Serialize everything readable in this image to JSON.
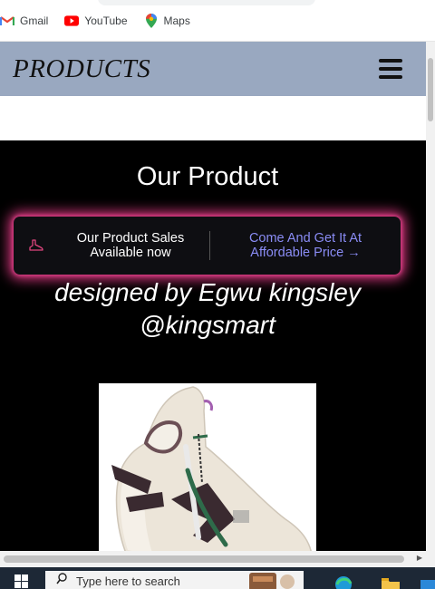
{
  "bookmarks": [
    {
      "label": "Gmail",
      "icon": "gmail-icon"
    },
    {
      "label": "YouTube",
      "icon": "youtube-icon"
    },
    {
      "label": "Maps",
      "icon": "maps-icon"
    }
  ],
  "navbar": {
    "brand": "PRODUCTS",
    "menu_icon": "hamburger-menu-icon",
    "bg_color": "#99a8c0"
  },
  "hero": {
    "title": "Our Product",
    "promo": {
      "left_line1": "Our Product Sales",
      "left_line2": "Available now",
      "right_line1": "Come And Get It At",
      "right_line2": "Affordable Price →",
      "glow_color": "#d9377f",
      "link_color": "#8a8cf5"
    },
    "credit_line1": "designed by Egwu kingsley",
    "credit_line2": "@kingsmart"
  },
  "taskbar": {
    "search_placeholder": "Type here to search"
  }
}
